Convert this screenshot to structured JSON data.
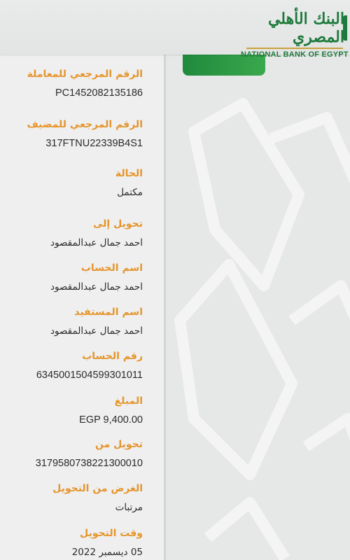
{
  "header": {
    "logo_arabic": "البنك الأهلي المصري",
    "logo_english": "NATIONAL BANK OF EGYPT"
  },
  "colors": {
    "label": "#e5952d",
    "brand_green": "#1e7a3c",
    "value": "#2b2b2b"
  },
  "details": {
    "transaction_ref": {
      "label": "الرقم المرجعي للمعاملة",
      "value": "PC1452082135186"
    },
    "host_ref": {
      "label": "الرقم المرجعي للمضيف",
      "value": "317FTNU22339B4S1"
    },
    "status": {
      "label": "الحالة",
      "value": "مكتمل"
    },
    "transfer_to": {
      "label": "تحويل إلى",
      "value": "احمد جمال عبدالمقصود"
    },
    "account_name": {
      "label": "اسم الحساب",
      "value": "احمد جمال عبدالمقصود"
    },
    "beneficiary_name": {
      "label": "اسم المستفيد",
      "value": "احمد جمال عبدالمقصود"
    },
    "account_number": {
      "label": "رقم الحساب",
      "value": "6345001504599301011"
    },
    "amount": {
      "label": "المبلغ",
      "value": "EGP 9,400.00"
    },
    "transfer_from": {
      "label": "تحويل من",
      "value": "3179580738221300010"
    },
    "purpose": {
      "label": "الغرض من التحويل",
      "value": "مرتبات"
    },
    "transfer_time": {
      "label": "وقت التحويل",
      "value": "05 ديسمبر 2022"
    }
  }
}
